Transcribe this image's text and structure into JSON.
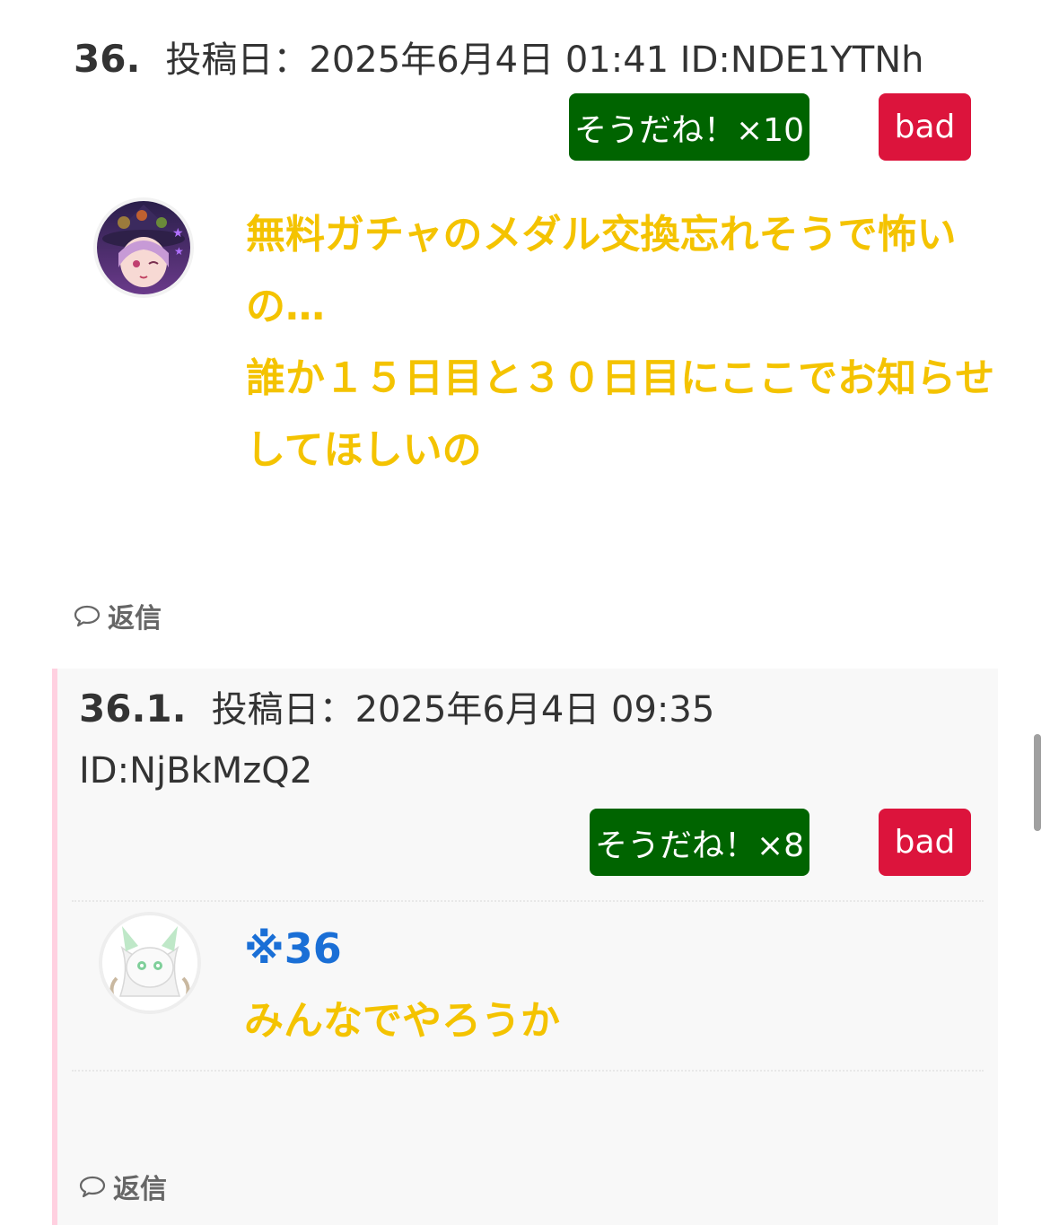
{
  "post": {
    "number": "36.",
    "meta": "投稿日：2025年6月4日 01:41 ID:NDE1YTNh",
    "agree_label": "そうだね！×10",
    "bad_label": "bad",
    "body_lines": [
      "無料ガチャのメダル交換忘れそうで怖い",
      "の…",
      "誰か１５日目と３０日目にここでお知らせ",
      "してほしいの"
    ],
    "reply_label": "返信"
  },
  "reply": {
    "number": "36.1.",
    "meta_line1": "投稿日：2025年6月4日 09:35",
    "meta_line2": "ID:NjBkMzQ2",
    "agree_label": "そうだね！×8",
    "bad_label": "bad",
    "anchor": "※36",
    "body": "みんなでやろうか",
    "reply_label": "返信"
  },
  "colors": {
    "agree": "#006400",
    "bad": "#dc143c",
    "body_text": "#f4c300",
    "anchor": "#1a6fd6",
    "child_border": "#ffd0e0"
  }
}
